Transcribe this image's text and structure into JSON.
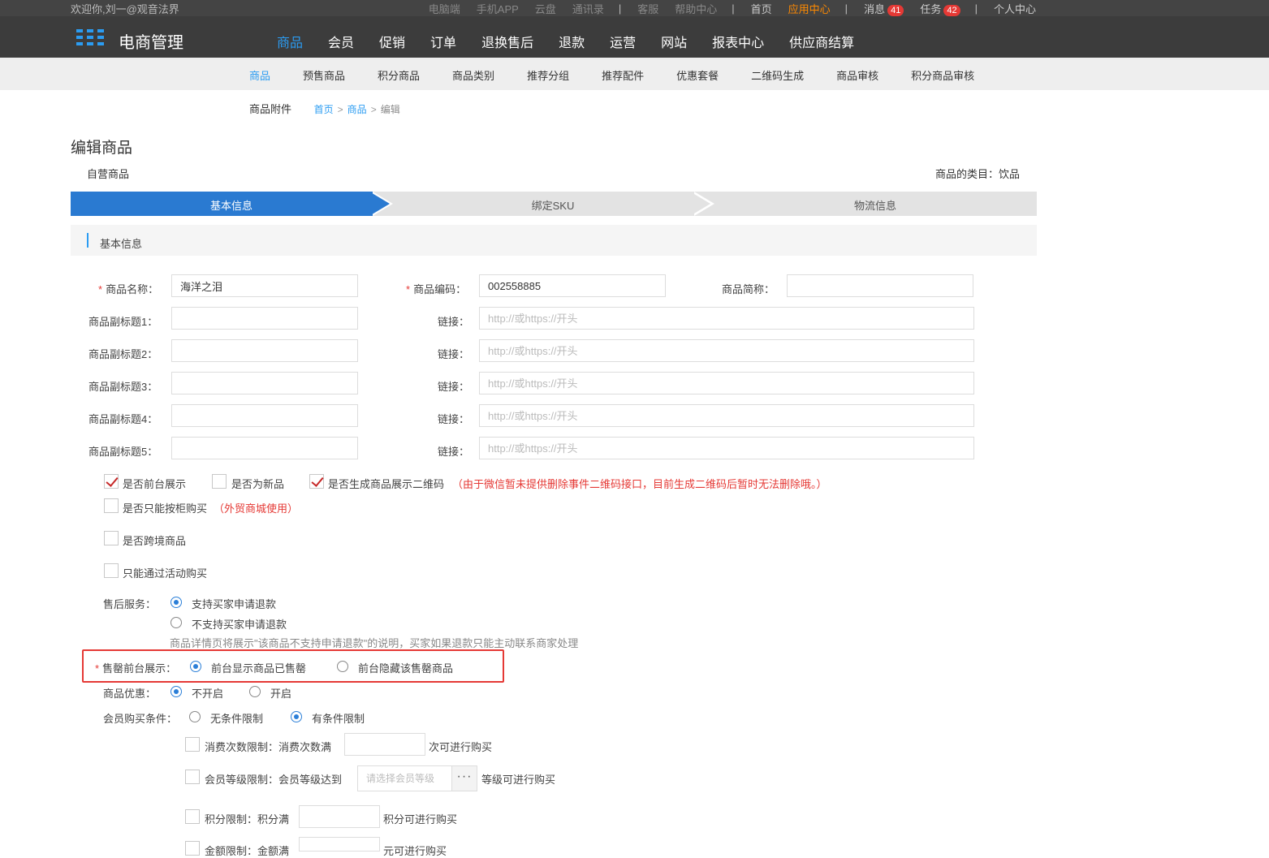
{
  "topbar": {
    "welcome": "欢迎你,刘一@观音法界",
    "links_gray": [
      "电脑端",
      "手机APP",
      "云盘",
      "通讯录"
    ],
    "links_gray2": [
      "客服",
      "帮助中心"
    ],
    "home": "首页",
    "app_center": "应用中心",
    "messages": "消息",
    "messages_count": "41",
    "tasks": "任务",
    "tasks_count": "42",
    "personal": "个人中心"
  },
  "header": {
    "title": "电商管理",
    "nav": [
      "商品",
      "会员",
      "促销",
      "订单",
      "退换售后",
      "退款",
      "运营",
      "网站",
      "报表中心",
      "供应商结算"
    ]
  },
  "subnav": [
    "商品",
    "预售商品",
    "积分商品",
    "商品类别",
    "推荐分组",
    "推荐配件",
    "优惠套餐",
    "二维码生成",
    "商品审核",
    "积分商品审核"
  ],
  "crumb": {
    "attachment": "商品附件",
    "home": "首页",
    "product": "商品",
    "current": "编辑",
    "sep": ">"
  },
  "page": {
    "title": "编辑商品",
    "self_operated": "自营商品",
    "category": "商品的类目：饮品"
  },
  "steps": [
    "基本信息",
    "绑定SKU",
    "物流信息"
  ],
  "section_title": "基本信息",
  "form": {
    "name_label": "商品名称：",
    "name_value": "海洋之泪",
    "code_label": "商品编码：",
    "code_value": "002558885",
    "short_label": "商品简称：",
    "short_value": "",
    "subtitles": [
      {
        "label": "商品副标题1：",
        "value": "",
        "link_label": "链接：",
        "link_placeholder": "http://或https://开头"
      },
      {
        "label": "商品副标题2：",
        "value": "",
        "link_label": "链接：",
        "link_placeholder": "http://或https://开头"
      },
      {
        "label": "商品副标题3：",
        "value": "",
        "link_label": "链接：",
        "link_placeholder": "http://或https://开头"
      },
      {
        "label": "商品副标题4：",
        "value": "",
        "link_label": "链接：",
        "link_placeholder": "http://或https://开头"
      },
      {
        "label": "商品副标题5：",
        "value": "",
        "link_label": "链接：",
        "link_placeholder": "http://或https://开头"
      }
    ],
    "cb_front_display": "是否前台展示",
    "cb_front_display_checked": true,
    "cb_new": "是否为新品",
    "cb_new_checked": false,
    "cb_qrcode": "是否生成商品展示二维码",
    "cb_qrcode_checked": true,
    "qrcode_note": "（由于微信暂未提供删除事件二维码接口，目前生成二维码后暂时无法删除哦。）",
    "cb_cabinet": "是否只能按柜购买",
    "cb_cabinet_note": "（外贸商城使用）",
    "cb_crossborder": "是否跨境商品",
    "cb_activity_only": "只能通过活动购买",
    "aftersale_label": "售后服务：",
    "aftersale_opt1": "支持买家申请退款",
    "aftersale_opt2": "不支持买家申请退款",
    "aftersale_hint": "商品详情页将展示\"该商品不支持申请退款\"的说明，买家如果退款只能主动联系商家处理",
    "soldout_label": "售罄前台展示：",
    "soldout_opt1": "前台显示商品已售罄",
    "soldout_opt2": "前台隐藏该售罄商品",
    "discount_label": "商品优惠：",
    "discount_opt1": "不开启",
    "discount_opt2": "开启",
    "member_cond_label": "会员购买条件：",
    "member_cond_opt1": "无条件限制",
    "member_cond_opt2": "有条件限制",
    "limit_consume_label": "消费次数限制：消费次数满",
    "limit_consume_suffix": "次可进行购买",
    "limit_level_label": "会员等级限制：会员等级达到",
    "limit_level_placeholder": "请选择会员等级",
    "limit_level_suffix": "等级可进行购买",
    "limit_points_label": "积分限制：积分满",
    "limit_points_suffix": "积分可进行购买",
    "limit_amount_label": "金额限制：金额满",
    "limit_amount_suffix": "元可进行购买",
    "more_button": "···"
  },
  "colors": {
    "accent": "#2b9cf2",
    "step_active": "#2a7ad1",
    "highlight_border": "#e53935",
    "header_bg": "#3c3c3c"
  }
}
